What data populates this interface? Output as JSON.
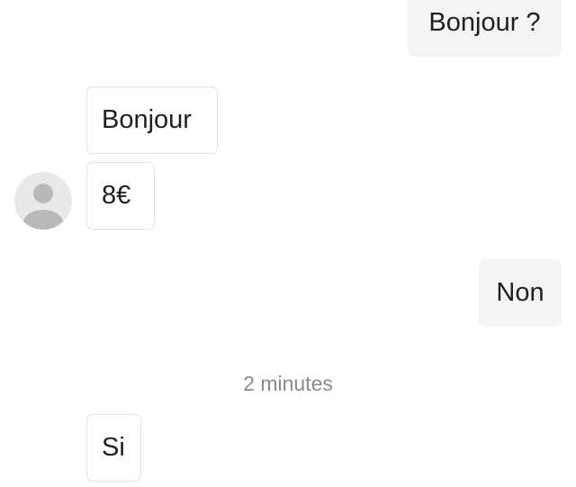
{
  "conversation": {
    "messages": [
      {
        "direction": "outgoing",
        "text": "Bonjour ?"
      },
      {
        "direction": "incoming",
        "text": "Bonjour"
      },
      {
        "direction": "incoming",
        "text": "8€"
      },
      {
        "direction": "outgoing",
        "text": "Non"
      },
      {
        "direction": "incoming",
        "text": "Si"
      }
    ],
    "timestamp": "2 minutes"
  },
  "avatar": {
    "icon": "default-user-avatar-icon"
  },
  "colors": {
    "outgoing_bubble": "#f4f4f5",
    "incoming_border": "#e3e3e3",
    "avatar_background": "#e9e9ea",
    "avatar_glyph": "#b9b9bb",
    "timestamp_text": "#8a8a8a"
  }
}
